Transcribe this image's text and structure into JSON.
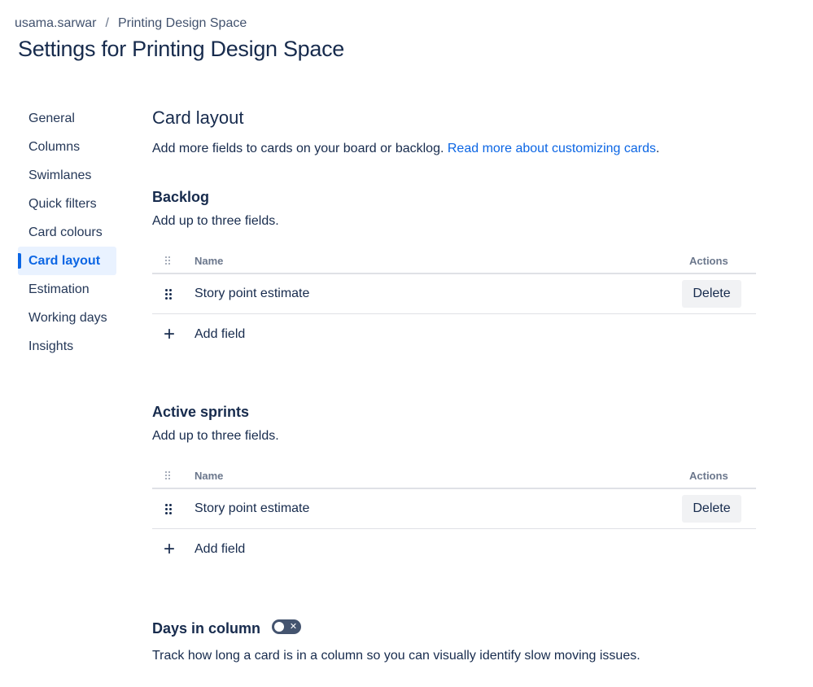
{
  "breadcrumb": {
    "user": "usama.sarwar",
    "separator": "/",
    "project": "Printing Design Space"
  },
  "page_title": "Settings for Printing Design Space",
  "sidebar": {
    "items": [
      {
        "label": "General"
      },
      {
        "label": "Columns"
      },
      {
        "label": "Swimlanes"
      },
      {
        "label": "Quick filters"
      },
      {
        "label": "Card colours"
      },
      {
        "label": "Card layout",
        "active": true
      },
      {
        "label": "Estimation"
      },
      {
        "label": "Working days"
      },
      {
        "label": "Insights"
      }
    ]
  },
  "card_layout": {
    "title": "Card layout",
    "description": "Add more fields to cards on your board or backlog.",
    "link_text": "Read more about customizing cards",
    "link_suffix": "."
  },
  "backlog": {
    "title": "Backlog",
    "description": "Add up to three fields.",
    "header_name": "Name",
    "header_actions": "Actions",
    "rows": [
      {
        "name": "Story point estimate",
        "action": "Delete"
      }
    ],
    "add_label": "Add field",
    "add_icon": "plus-icon"
  },
  "active_sprints": {
    "title": "Active sprints",
    "description": "Add up to three fields.",
    "header_name": "Name",
    "header_actions": "Actions",
    "rows": [
      {
        "name": "Story point estimate",
        "action": "Delete"
      }
    ],
    "add_label": "Add field",
    "add_icon": "plus-icon"
  },
  "days_in_column": {
    "title": "Days in column",
    "toggle_on": false,
    "description": "Track how long a card is in a column so you can visually identify slow moving issues."
  },
  "colors": {
    "accent": "#0c66e4",
    "active_bg": "#e9f2ff",
    "text": "#172b4d",
    "toggle_off": "#44546f",
    "button_bg": "#f1f2f4"
  }
}
